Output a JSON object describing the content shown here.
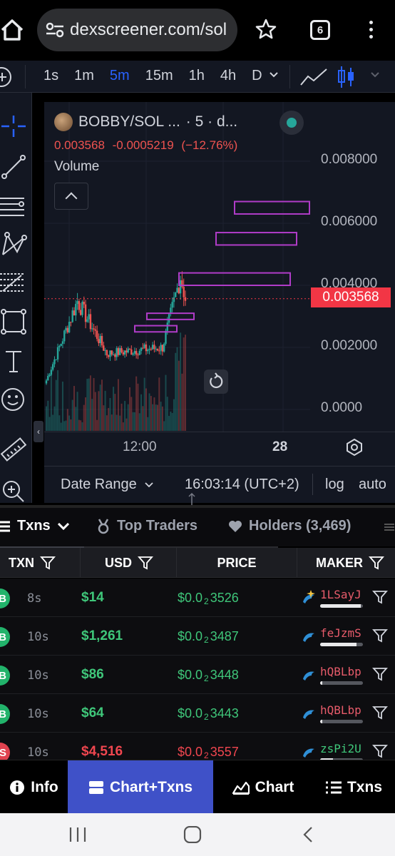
{
  "browser": {
    "url": "dexscreener.com/sol",
    "tab_count": "6"
  },
  "toolbar": {
    "intervals": [
      "1s",
      "1m",
      "5m",
      "15m",
      "1h",
      "4h",
      "D"
    ],
    "active_interval": "5m"
  },
  "chart": {
    "symbol": "BOBBY/SOL ...",
    "resolution": "· 5 · d...",
    "price": "0.003568",
    "change": "-0.0005219",
    "change_pct": "(−12.76%)",
    "volume_label": "Volume",
    "last_price_tag": "0.003568",
    "y_ticks": [
      "0.008000",
      "0.006000",
      "0.004000",
      "0.002000",
      "0.0000"
    ],
    "x_ticks": [
      "12:00",
      "28"
    ],
    "date_range_label": "Date Range",
    "clock": "16:03:14 (UTC+2)",
    "log_label": "log",
    "auto_label": "auto"
  },
  "chart_data": {
    "type": "candlestick",
    "title": "",
    "ylim": [
      0,
      0.009
    ],
    "x_ticks": [
      "12:00",
      "28"
    ],
    "y_ticks": [
      0.008,
      0.006,
      0.004,
      0.002,
      0.0
    ],
    "last_price": 0.003568,
    "trend_segments": [
      {
        "phase": "rise",
        "from": 0.0008,
        "to": 0.0035
      },
      {
        "phase": "pullback",
        "from": 0.0035,
        "to": 0.0018
      },
      {
        "phase": "sideways",
        "from": 0.0018,
        "to": 0.002
      },
      {
        "phase": "pump",
        "from": 0.002,
        "to": 0.0043
      },
      {
        "phase": "last",
        "from": 0.0043,
        "to": 0.003568
      }
    ],
    "overlay_boxes": [
      {
        "y_low": 0.0063,
        "y_high": 0.0067
      },
      {
        "y_low": 0.0053,
        "y_high": 0.0057
      },
      {
        "y_low": 0.004,
        "y_high": 0.0044
      },
      {
        "y_low": 0.0029,
        "y_high": 0.0031
      },
      {
        "y_low": 0.0025,
        "y_high": 0.0027
      }
    ]
  },
  "txn_tabs": {
    "txns": "Txns",
    "top_traders": "Top Traders",
    "holders": "Holders (3,469)"
  },
  "table": {
    "headers": [
      "TXN",
      "USD",
      "PRICE",
      "MAKER"
    ],
    "rows": [
      {
        "side": "B",
        "type": "buy",
        "age": "8s",
        "usd": "$14",
        "price_prefix": "$0.0",
        "price_sub": "2",
        "price_digits": "3526",
        "maker": "1LSayJ",
        "maker_icon": "sparkle-dolphin-icon",
        "balance": 0.95
      },
      {
        "side": "B",
        "type": "buy",
        "age": "10s",
        "usd": "$1,261",
        "price_prefix": "$0.0",
        "price_sub": "2",
        "price_digits": "3487",
        "maker": "feJzmS",
        "maker_icon": "dolphin-icon",
        "balance": 0.85
      },
      {
        "side": "B",
        "type": "buy",
        "age": "10s",
        "usd": "$86",
        "price_prefix": "$0.0",
        "price_sub": "2",
        "price_digits": "3448",
        "maker": "hQBLbp",
        "maker_icon": "dolphin-icon",
        "balance": 0.05
      },
      {
        "side": "B",
        "type": "buy",
        "age": "10s",
        "usd": "$64",
        "price_prefix": "$0.0",
        "price_sub": "2",
        "price_digits": "3443",
        "maker": "hQBLbp",
        "maker_icon": "dolphin-icon",
        "balance": 0.05
      },
      {
        "side": "S",
        "type": "sell",
        "age": "10s",
        "usd": "$4,516",
        "price_prefix": "$0.0",
        "price_sub": "2",
        "price_digits": "3557",
        "maker": "zsPi2U",
        "maker_icon": "dolphin-icon",
        "balance": 0.3
      }
    ]
  },
  "bottom_nav": {
    "info": "Info",
    "chart_txns": "Chart+Txns",
    "chart": "Chart",
    "txns": "Txns"
  },
  "colors": {
    "accent_blue": "#2962ff",
    "nav_active": "#3f51c8",
    "up": "#26a69a",
    "down": "#ef5350",
    "box": "#b03cc8"
  }
}
